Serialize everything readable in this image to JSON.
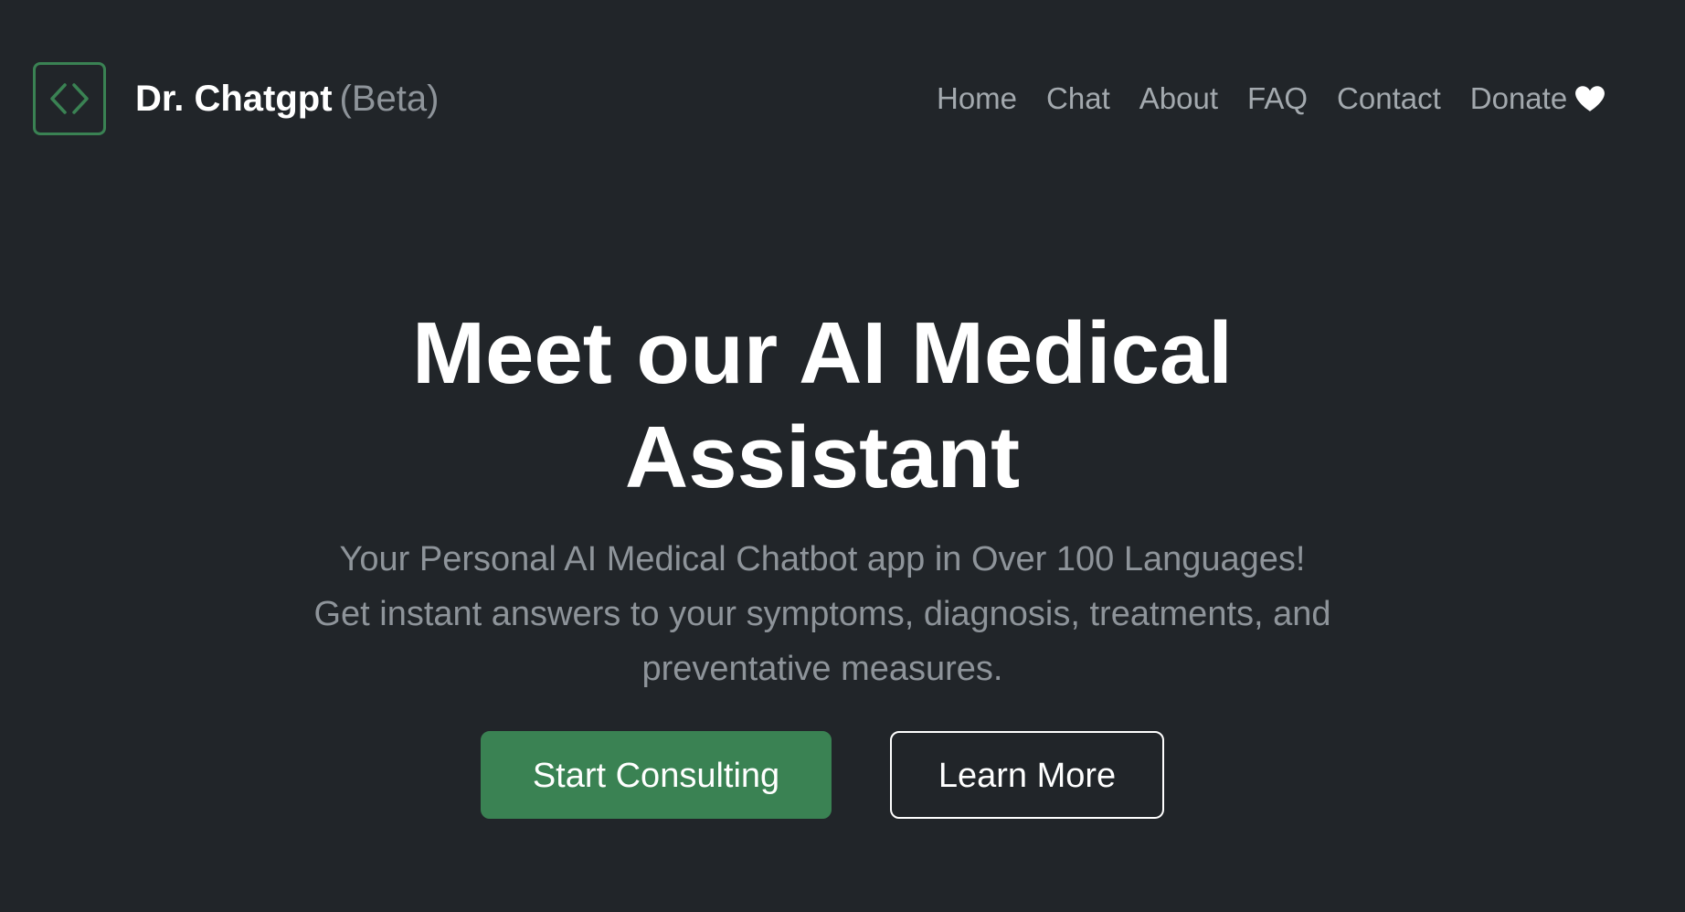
{
  "brand": {
    "name": "Dr. Chatgpt",
    "tag": "(Beta)",
    "logo_icon": "code-brackets-icon",
    "accent_color": "#3a8253"
  },
  "nav": {
    "items": [
      {
        "label": "Home"
      },
      {
        "label": "Chat"
      },
      {
        "label": "About"
      },
      {
        "label": "FAQ"
      },
      {
        "label": "Contact"
      },
      {
        "label": "Donate",
        "icon": "heart-icon"
      }
    ]
  },
  "hero": {
    "title": "Meet our AI Medical Assistant",
    "lead": "Your Personal AI Medical Chatbot app in Over 100 Languages! Get instant answers to your symptoms, diagnosis, treatments, and preventative measures.",
    "primary_button": "Start Consulting",
    "secondary_button": "Learn More"
  },
  "colors": {
    "background": "#212529",
    "primary": "#3a8253",
    "muted_text": "#8e949a"
  }
}
